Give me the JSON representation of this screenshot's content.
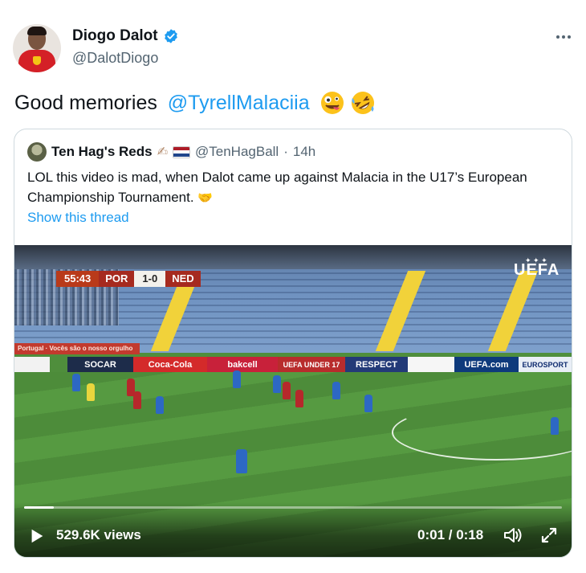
{
  "author": {
    "display_name": "Diogo Dalot",
    "handle": "@DalotDiogo",
    "verified": true
  },
  "tweet": {
    "text_prefix": "Good memories ",
    "mention": "@TyrellMalaciia",
    "emojis": [
      "zany-face-emoji",
      "rolling-laughing-emoji"
    ]
  },
  "quoted_tweet": {
    "display_name": "Ten Hag's Reds",
    "name_emojis": [
      "writing-hand-emoji",
      "netherlands-flag-emoji"
    ],
    "handle": "@TenHagBall",
    "separator": "·",
    "time": "14h",
    "text": "LOL this video is mad, when Dalot came up against Malacia in the U17’s European Championship Tournament.",
    "show_thread": "Show this thread"
  },
  "video": {
    "scorebug": {
      "time": "55:43",
      "home": "POR",
      "score": "1-0",
      "away": "NED"
    },
    "broadcaster_logo": "UEFA",
    "ad_boards": [
      "SOCAR",
      "Coca-Cola",
      "bakcell",
      "UEFA UNDER 17",
      "RESPECT",
      "UEFA.com",
      "EUROSPORT"
    ],
    "banner": "Portugal · Vocês são o nosso orgulho",
    "views": "529.6K views",
    "time_display": "0:01 / 0:18",
    "progress_fraction": 0.055
  },
  "colors": {
    "link": "#1d9bf0",
    "text": "#0f1419",
    "muted": "#536471",
    "border": "#cfd9de"
  }
}
